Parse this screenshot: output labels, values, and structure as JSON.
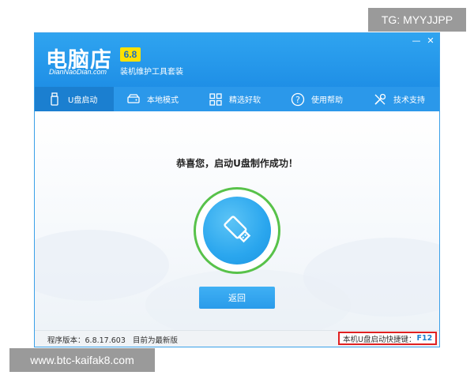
{
  "watermarks": {
    "top": "TG: MYYJJPP",
    "bottom": "www.btc-kaifak8.com"
  },
  "app": {
    "logo_text": "电脑店",
    "logo_subtext": "DianNaoDian.com",
    "version": "6.8",
    "subtitle": "装机维护工具套装",
    "window_controls": {
      "minimize": "—",
      "close": "✕"
    }
  },
  "tabs": [
    {
      "label": "U盘启动",
      "icon": "usb-drive-icon",
      "active": true
    },
    {
      "label": "本地模式",
      "icon": "hard-disk-icon",
      "active": false
    },
    {
      "label": "精选好软",
      "icon": "grid-apps-icon",
      "active": false
    },
    {
      "label": "使用帮助",
      "icon": "help-icon",
      "active": false
    },
    {
      "label": "技术支持",
      "icon": "tools-icon",
      "active": false
    }
  ],
  "main": {
    "success_message": "恭喜您，启动U盘制作成功！",
    "success_icon": "usb-drive-icon",
    "return_button": "返回"
  },
  "status": {
    "version_label": "程序版本：6.8.17.603",
    "latest_label": "目前为最新版",
    "hotkey_label": "本机U盘启动快捷键：",
    "hotkey_value": "F12"
  },
  "colors": {
    "primary": "#2b98ea",
    "active_tab": "#1b7fd0",
    "success_ring": "#58c24a",
    "version_badge": "#ffe100",
    "hotkey_border": "#e02020"
  }
}
